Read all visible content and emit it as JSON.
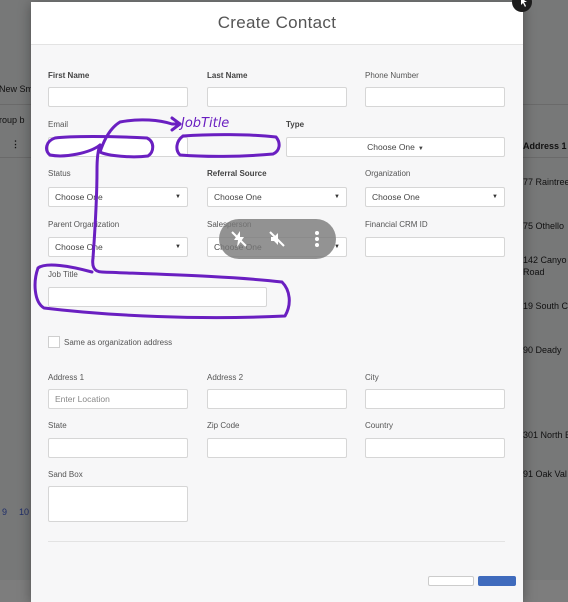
{
  "background": {
    "fragments": [
      "New Sm",
      "roup b",
      "⋮",
      "Address 1",
      "77 Raintree",
      "75 Othello",
      "142 Canyo",
      "Road",
      "19 South C",
      "90 Deady",
      "301 North B",
      "91 Oak Val",
      "9",
      "10"
    ]
  },
  "modal": {
    "title": "Create Contact",
    "fields": {
      "first_name": {
        "label": "First Name",
        "value": ""
      },
      "last_name": {
        "label": "Last Name",
        "value": ""
      },
      "phone_number": {
        "label": "Phone Number",
        "value": ""
      },
      "email": {
        "label": "Email",
        "value": ""
      },
      "type": {
        "label": "Type",
        "selected": "Choose One"
      },
      "status": {
        "label": "Status",
        "selected": "Choose One"
      },
      "referral_source": {
        "label": "Referral Source",
        "selected": "Choose One"
      },
      "organization": {
        "label": "Organization",
        "selected": "Choose One"
      },
      "parent_organization": {
        "label": "Parent Organization",
        "selected": "Choose One"
      },
      "salesperson": {
        "label": "Salesperson",
        "selected": "Choose One"
      },
      "financial_crm_id": {
        "label": "Financial CRM ID",
        "value": ""
      },
      "job_title": {
        "label": "Job Title",
        "value": ""
      },
      "same_as_org": {
        "label": "Same as organization address",
        "checked": false
      },
      "address1": {
        "label": "Address 1",
        "placeholder": "Enter Location"
      },
      "address2": {
        "label": "Address 2",
        "value": ""
      },
      "city": {
        "label": "City",
        "value": ""
      },
      "state": {
        "label": "State",
        "value": ""
      },
      "zip": {
        "label": "Zip Code",
        "value": ""
      },
      "country": {
        "label": "Country",
        "value": ""
      },
      "sandbox": {
        "label": "Sand Box",
        "value": ""
      }
    }
  },
  "annotation": {
    "text": "JobTitle",
    "color": "#6a1fc1"
  },
  "media_overlay": {
    "icons": [
      "flash-off-icon",
      "mute-icon",
      "more-vertical-icon"
    ]
  },
  "colors": {
    "overlay": "#787878",
    "primary": "#3f6bbd"
  }
}
